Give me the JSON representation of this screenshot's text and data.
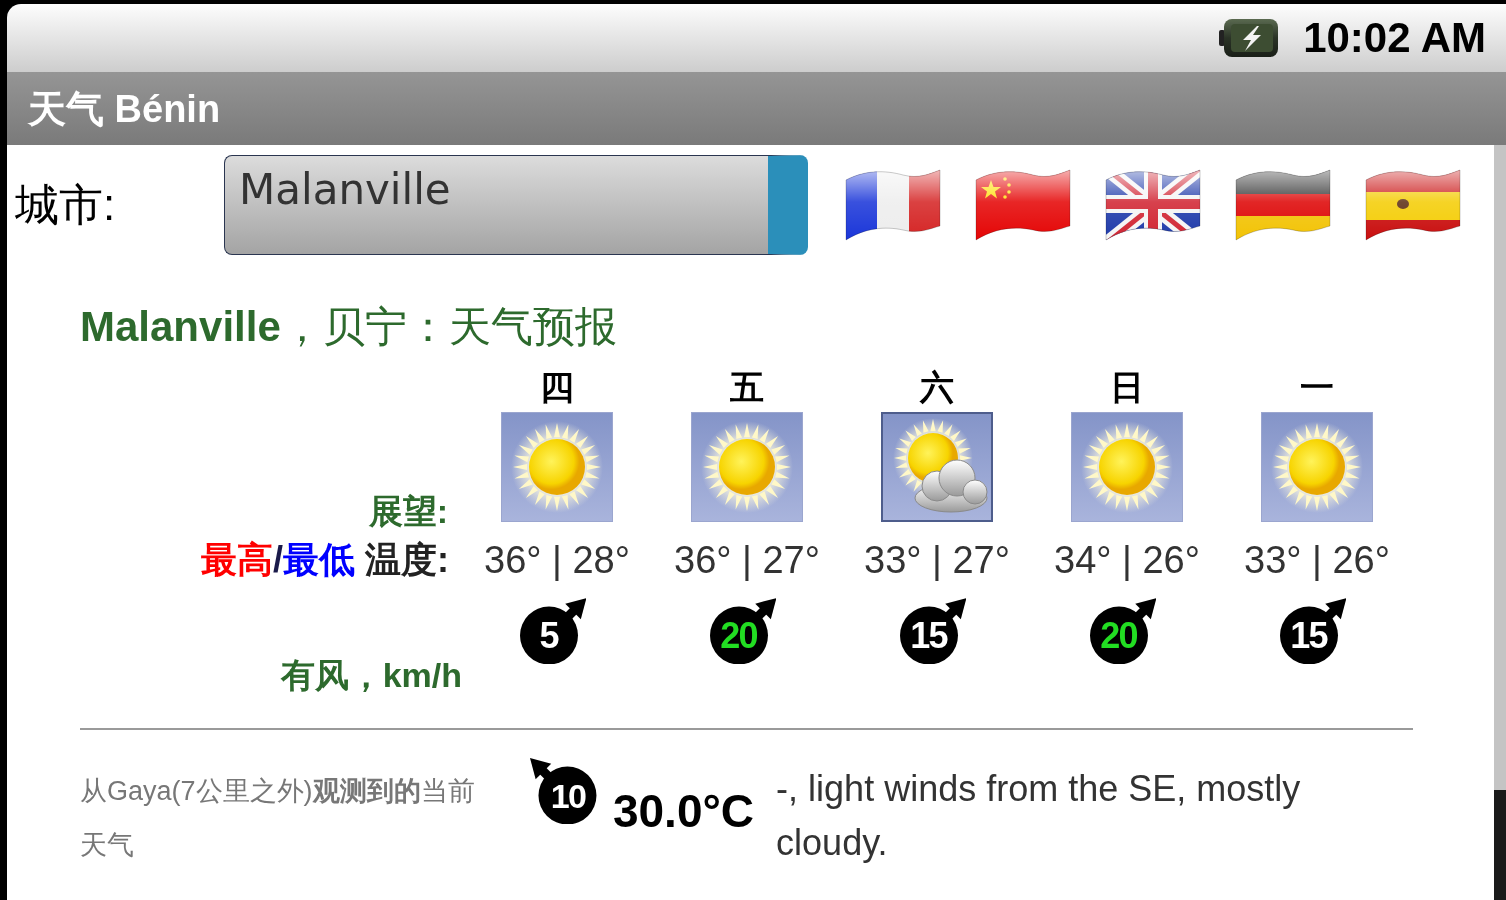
{
  "status_bar": {
    "time": "10:02 AM"
  },
  "title_bar": {
    "title": "天气 Bénin"
  },
  "city": {
    "label": "城市:",
    "value": "Malanville"
  },
  "forecast": {
    "heading": "**Malanville**，贝宁：天气预报",
    "outlook_label": "展望:",
    "temp_label": {
      "high": "最高",
      "separator": "/",
      "low": "最低",
      "suffix": "温度:"
    },
    "wind_label": "有风，km/h",
    "days": [
      {
        "day": "四",
        "kind": "sunny",
        "temps": "36° | 28°",
        "wind": {
          "speed": "5",
          "kind": "northeast",
          "color": "#ffffff"
        }
      },
      {
        "day": "五",
        "kind": "sunny",
        "temps": "36° | 27°",
        "wind": {
          "speed": "20",
          "kind": "northeast",
          "color": "#22dd22"
        }
      },
      {
        "day": "六",
        "kind": "partly_cloudy",
        "temps": "33° | 27°",
        "wind": {
          "speed": "15",
          "kind": "northeast",
          "color": "#ffffff"
        }
      },
      {
        "day": "日",
        "kind": "sunny",
        "temps": "34° | 26°",
        "wind": {
          "speed": "20",
          "kind": "northeast",
          "color": "#22dd22"
        }
      },
      {
        "day": "一",
        "kind": "sunny",
        "temps": "33° | 26°",
        "wind": {
          "speed": "15",
          "kind": "northeast",
          "color": "#ffffff"
        }
      }
    ]
  },
  "current": {
    "observation": "从Gaya(7公里之外)**观测到的**当前天气",
    "wind": {
      "speed": "10",
      "kind": "northwest",
      "color": "#ffffff"
    },
    "temperature": "30.0°C",
    "description": "-, light winds from the SE, mostly cloudy."
  }
}
